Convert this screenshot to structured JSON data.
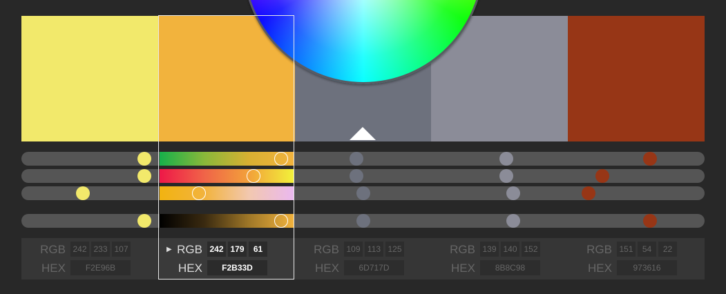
{
  "colors": [
    {
      "hex_color": "#F2E96B",
      "rgb_label": "RGB",
      "hex_label": "HEX",
      "r": "242",
      "g": "233",
      "b": "107",
      "hex": "F2E96B"
    },
    {
      "hex_color": "#F2B33D",
      "rgb_label": "RGB",
      "hex_label": "HEX",
      "r": "242",
      "g": "179",
      "b": "61",
      "hex": "F2B33D"
    },
    {
      "hex_color": "#6D717D",
      "rgb_label": "RGB",
      "hex_label": "HEX",
      "r": "109",
      "g": "113",
      "b": "125",
      "hex": "6D717D"
    },
    {
      "hex_color": "#8B8C98",
      "rgb_label": "RGB",
      "hex_label": "HEX",
      "r": "139",
      "g": "140",
      "b": "152",
      "hex": "8B8C98"
    },
    {
      "hex_color": "#973616",
      "rgb_label": "RGB",
      "hex_label": "HEX",
      "r": "151",
      "g": "54",
      "b": "22",
      "hex": "973616"
    }
  ],
  "selected_index": 1,
  "slider_levels": {
    "hue": [
      0.18,
      0.38,
      0.49,
      0.71,
      0.92
    ],
    "saturation": [
      0.18,
      0.34,
      0.49,
      0.71,
      0.85
    ],
    "lightness": [
      0.09,
      0.26,
      0.5,
      0.72,
      0.83
    ],
    "brightness": [
      0.18,
      0.38,
      0.5,
      0.72,
      0.92
    ]
  },
  "selected_track_gradients": {
    "hue": "linear-gradient(90deg, #16b04a, #8ab83a, #d9b032, #f2b33d)",
    "saturation": "linear-gradient(90deg, #ee1848, #f06448, #f2a23a, #f2f23a)",
    "lightness": "linear-gradient(90deg, #f2b310, #f2b33d, #f2c8b0, #eab8f0)",
    "brightness": "linear-gradient(90deg, #000000, #3a2a10, #a07828, #f2b33d)"
  }
}
